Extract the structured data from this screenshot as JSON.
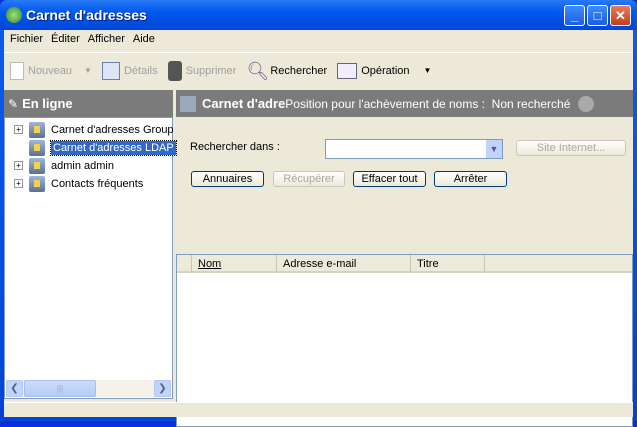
{
  "window": {
    "title": "Carnet d'adresses"
  },
  "menu": [
    "Fichier",
    "Éditer",
    "Afficher",
    "Aide"
  ],
  "toolbar": {
    "new": "Nouveau",
    "details": "Détails",
    "delete": "Supprimer",
    "search": "Rechercher",
    "operation": "Opération"
  },
  "left": {
    "header": "En ligne",
    "tree": [
      "Carnet d'adresses Group",
      "Carnet d'adresses LDAP",
      "admin admin",
      "Contacts fréquents"
    ]
  },
  "right": {
    "header_title": "Carnet d'adre",
    "header_status": "Position pour l'achèvement de noms :  Non recherché",
    "search_in_label": "Rechercher dans :",
    "search_in_value": "",
    "site_button": "Site Internet...",
    "buttons": {
      "directories": "Annuaires",
      "retrieve": "Récupérer",
      "clear": "Effacer tout",
      "stop": "Arrêter"
    },
    "columns": [
      "Nom",
      "Adresse e-mail",
      "Titre"
    ]
  }
}
